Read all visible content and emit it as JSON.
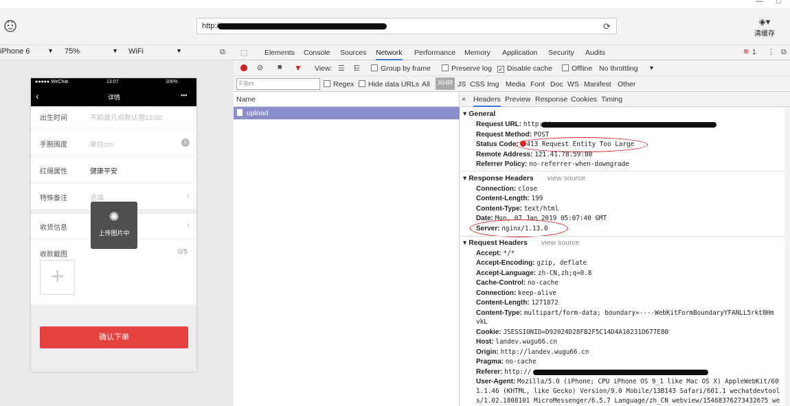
{
  "window": {
    "minimize": "—",
    "maximize": "□",
    "close": "✕"
  },
  "topbar": {
    "url_prefix": "http://",
    "cache_label": "清缓存"
  },
  "device_bar": {
    "device": "iPhone 6",
    "zoom": "75%",
    "network": "WiFi"
  },
  "phone": {
    "status_carrier": "●●●●● WeChat",
    "status_time": "13:07",
    "status_battery": "100%",
    "nav_title": "详情",
    "nav_more": "•••",
    "rows": [
      {
        "label": "出生时间",
        "value": "不知道几点默认用12:00"
      },
      {
        "label": "手腕围度",
        "value": "单位cm"
      },
      {
        "label": "红绳属性",
        "value": "健康平安"
      },
      {
        "label": "特殊备注",
        "value": "选填"
      },
      {
        "label": "收货信息",
        "value": ""
      },
      {
        "label": "收款截图",
        "value": "0/5"
      }
    ],
    "toast": "上传图片中",
    "confirm_button": "确认下单"
  },
  "devtools": {
    "tabs": [
      "Elements",
      "Console",
      "Sources",
      "Network",
      "Performance",
      "Memory",
      "Application",
      "Security",
      "Audits"
    ],
    "active_tab": "Network",
    "error_count": "1",
    "toolbar": {
      "view": "View:",
      "group_by_frame": "Group by frame",
      "preserve_log": "Preserve log",
      "disable_cache": "Disable cache",
      "offline": "Offline",
      "throttling": "No throttling"
    },
    "filter": {
      "placeholder": "Filter",
      "regex": "Regex",
      "hide_data_urls": "Hide data URLs",
      "types": [
        "All",
        "XHR",
        "JS",
        "CSS",
        "Img",
        "Media",
        "Font",
        "Doc",
        "WS",
        "Manifest",
        "Other"
      ]
    },
    "list_header": "Name",
    "requests": [
      {
        "name": "upload"
      }
    ],
    "detail_tabs": [
      "Headers",
      "Preview",
      "Response",
      "Cookies",
      "Timing"
    ],
    "general_title": "General",
    "general": [
      {
        "k": "Request URL:",
        "v": "http://"
      },
      {
        "k": "Request Method:",
        "v": "POST"
      },
      {
        "k": "Status Code:",
        "v": "413 Request Entity Too Large"
      },
      {
        "k": "Remote Address:",
        "v": "121.41.78.59:80"
      },
      {
        "k": "Referrer Policy:",
        "v": "no-referrer-when-downgrade"
      }
    ],
    "response_title": "Response Headers",
    "view_source": "view source",
    "response": [
      {
        "k": "Connection:",
        "v": "close"
      },
      {
        "k": "Content-Length:",
        "v": "199"
      },
      {
        "k": "Content-Type:",
        "v": "text/html"
      },
      {
        "k": "Date:",
        "v": "Mon, 07 Jan 2019 05:07:40 GMT"
      },
      {
        "k": "Server:",
        "v": "nginx/1.13.0"
      }
    ],
    "request_title": "Request Headers",
    "request": [
      {
        "k": "Accept:",
        "v": "*/*"
      },
      {
        "k": "Accept-Encoding:",
        "v": "gzip, deflate"
      },
      {
        "k": "Accept-Language:",
        "v": "zh-CN,zh;q=0.8"
      },
      {
        "k": "Cache-Control:",
        "v": "no-cache"
      },
      {
        "k": "Connection:",
        "v": "keep-alive"
      },
      {
        "k": "Content-Length:",
        "v": "1271872"
      },
      {
        "k": "Content-Type:",
        "v": "multipart/form-data; boundary=----WebKitFormBoundaryYFANLL5rkt8Hm"
      },
      {
        "k": "",
        "v": "vkL"
      },
      {
        "k": "Cookie:",
        "v": "JSESSIONID=D92024D28FB2F5C14D4A10231D677E80"
      },
      {
        "k": "Host:",
        "v": "landev.wugu66.cn"
      },
      {
        "k": "Origin:",
        "v": "http://landev.wugu66.cn"
      },
      {
        "k": "Pragma:",
        "v": "no-cache"
      },
      {
        "k": "Referer:",
        "v": "http://"
      },
      {
        "k": "User-Agent:",
        "v": "Mozilla/5.0 (iPhone; CPU iPhone OS 9_1 like Mac OS X) AppleWebKit/60"
      },
      {
        "k": "",
        "v": "1.1.46 (KHTML, like Gecko) Version/9.0 Mobile/13B143 Safari/601.1 wechatdevtool"
      },
      {
        "k": "",
        "v": "s/1.02.1808101 MicroMessenger/6.5.7 Language/zh_CN webview/15468376273432675 we"
      }
    ]
  },
  "colors": {
    "accent": "#3879d9",
    "selected_row": "#8a8fcc",
    "confirm": "#e64340",
    "error": "#d62020"
  }
}
